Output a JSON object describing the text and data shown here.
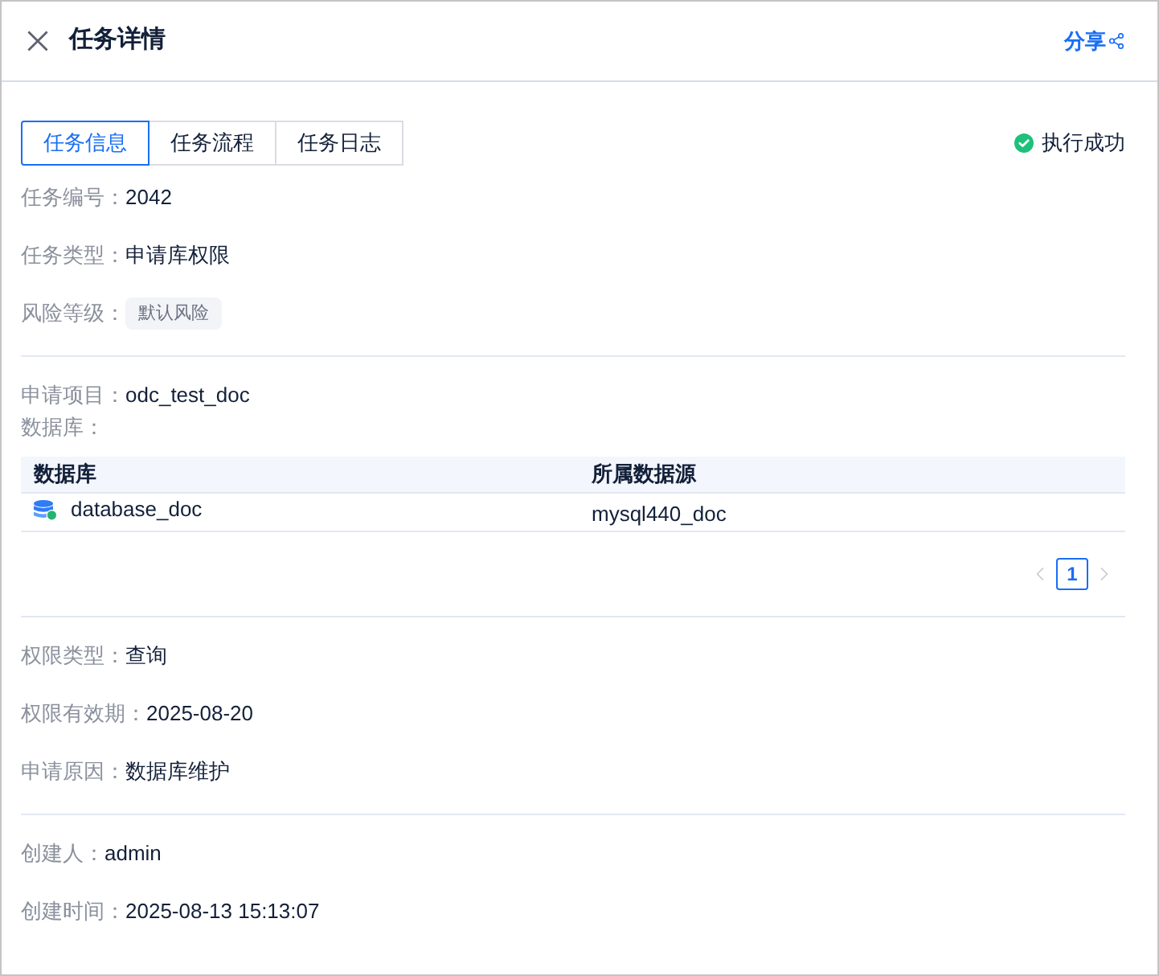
{
  "header": {
    "title": "任务详情",
    "share": "分享"
  },
  "tabs": [
    {
      "label": "任务信息",
      "selected": true
    },
    {
      "label": "任务流程",
      "selected": false
    },
    {
      "label": "任务日志",
      "selected": false
    }
  ],
  "status": {
    "kind": "success",
    "text": "执行成功"
  },
  "sections": [
    {
      "items": [
        {
          "kind": "field",
          "label": "任务编号：",
          "value": "2042"
        },
        {
          "kind": "field",
          "label": "任务类型：",
          "value": "申请库权限"
        },
        {
          "kind": "tag",
          "label": "风险等级：",
          "value": "默认风险"
        }
      ]
    },
    {
      "items": [
        {
          "kind": "field",
          "label": "申请项目：",
          "value": "odc_test_doc"
        },
        {
          "kind": "table",
          "label": "数据库：",
          "columns": [
            "数据库",
            "所属数据源"
          ],
          "rows": [
            [
              "database_doc",
              "mysql440_doc"
            ]
          ],
          "pagination": {
            "prev_disabled": true,
            "next_disabled": true,
            "pages": [
              {
                "label": "1",
                "selected": true
              }
            ]
          }
        }
      ]
    },
    {
      "items": [
        {
          "kind": "field",
          "label": "权限类型：",
          "value": "查询"
        },
        {
          "kind": "field",
          "label": "权限有效期：",
          "value": "2025-08-20"
        },
        {
          "kind": "field",
          "label": "申请原因：",
          "value": "数据库维护"
        }
      ]
    },
    {
      "items": [
        {
          "kind": "field",
          "label": "创建人：",
          "value": "admin"
        },
        {
          "kind": "field",
          "label": "创建时间：",
          "value": "2025-08-13 15:13:07"
        }
      ]
    }
  ]
}
